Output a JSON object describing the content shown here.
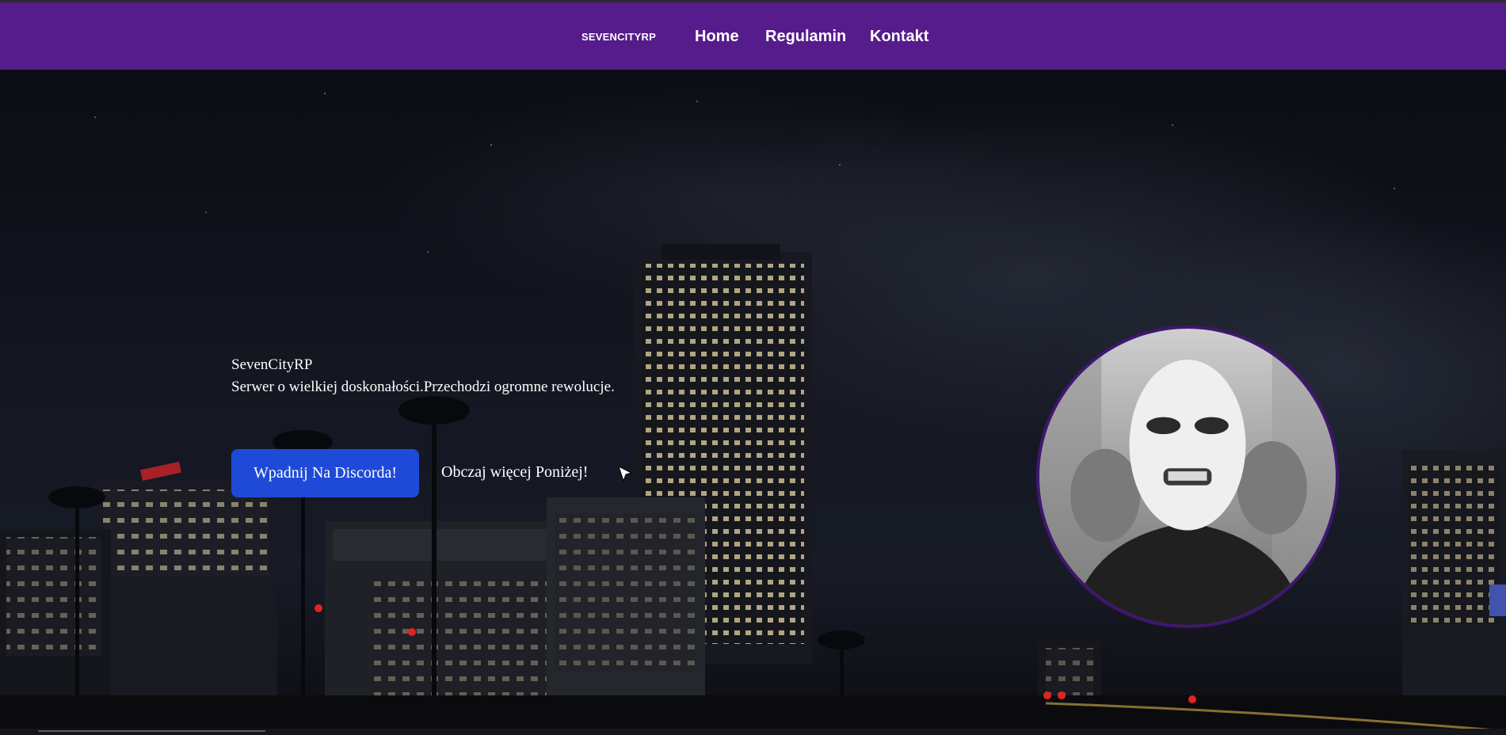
{
  "nav": {
    "brand": "SEVENCITYRP",
    "links": [
      {
        "label": "Home"
      },
      {
        "label": "Regulamin"
      },
      {
        "label": "Kontakt"
      }
    ]
  },
  "hero": {
    "title": "SevenCityRP",
    "subtitle": "Serwer o wielkiej doskonałości.Przechodzi ogromne rewolucje.",
    "discord_button": "Wpadnij Na Discorda!",
    "more_link": "Obczaj więcej Poniżej!",
    "background": "night-city-skyline",
    "avatar": "masked-person-portrait"
  },
  "colors": {
    "navbar": "#561c8b",
    "button": "#1f4ad8",
    "avatar_border": "#3f1670",
    "text": "#ffffff"
  }
}
